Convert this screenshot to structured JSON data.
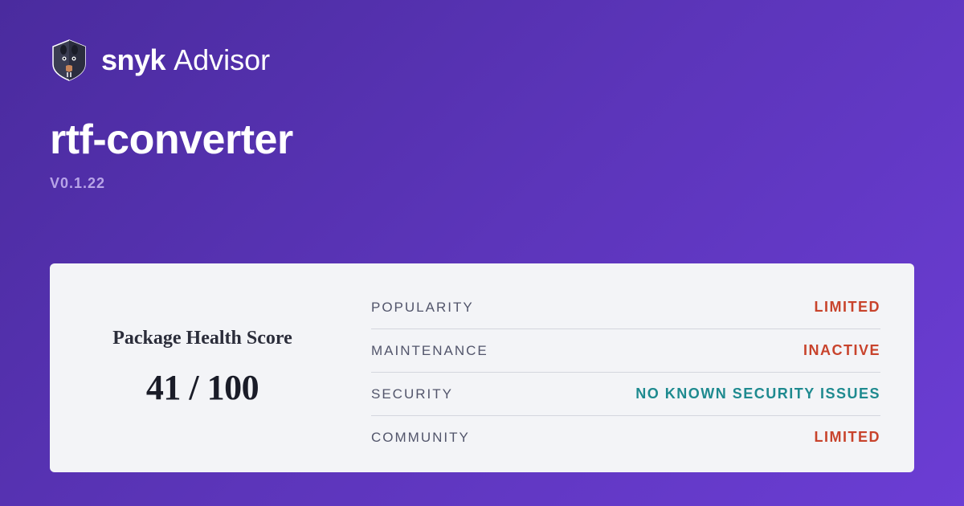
{
  "brand": {
    "name": "snyk",
    "product": "Advisor"
  },
  "package": {
    "name": "rtf-converter",
    "version": "V0.1.22"
  },
  "score": {
    "label": "Package Health Score",
    "value": "41 / 100"
  },
  "metrics": [
    {
      "label": "POPULARITY",
      "value": "LIMITED",
      "status": "negative"
    },
    {
      "label": "MAINTENANCE",
      "value": "INACTIVE",
      "status": "negative"
    },
    {
      "label": "SECURITY",
      "value": "NO KNOWN SECURITY ISSUES",
      "status": "positive"
    },
    {
      "label": "COMMUNITY",
      "value": "LIMITED",
      "status": "negative"
    }
  ]
}
